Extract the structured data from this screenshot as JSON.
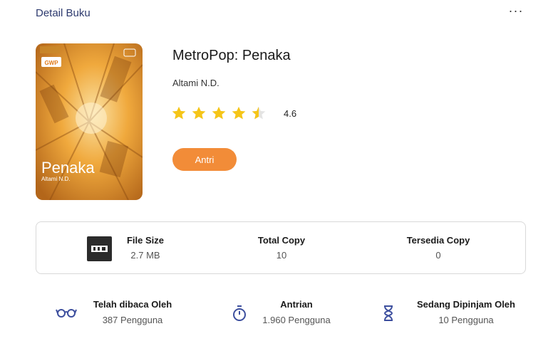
{
  "header": {
    "title": "Detail Buku",
    "more_label": "···"
  },
  "cover": {
    "publisher_badge": "GWP",
    "title": "Penaka",
    "author": "Altami N.D."
  },
  "book": {
    "title": "MetroPop: Penaka",
    "author": "Altami N.D.",
    "rating": 4.6,
    "rating_label": "4.6",
    "queue_button": "Antri"
  },
  "info": {
    "file_size_label": "File Size",
    "file_size_value": "2.7 MB",
    "total_copy_label": "Total Copy",
    "total_copy_value": "10",
    "available_copy_label": "Tersedia Copy",
    "available_copy_value": "0"
  },
  "stats": {
    "read_label": "Telah dibaca Oleh",
    "read_value": "387 Pengguna",
    "queue_label": "Antrian",
    "queue_value": "1.960 Pengguna",
    "borrowed_label": "Sedang Dipinjam Oleh",
    "borrowed_value": "10 Pengguna"
  },
  "colors": {
    "accent": "#f28c38",
    "star": "#f5c518",
    "icon": "#3d4f9e",
    "header": "#2d3a6e"
  }
}
